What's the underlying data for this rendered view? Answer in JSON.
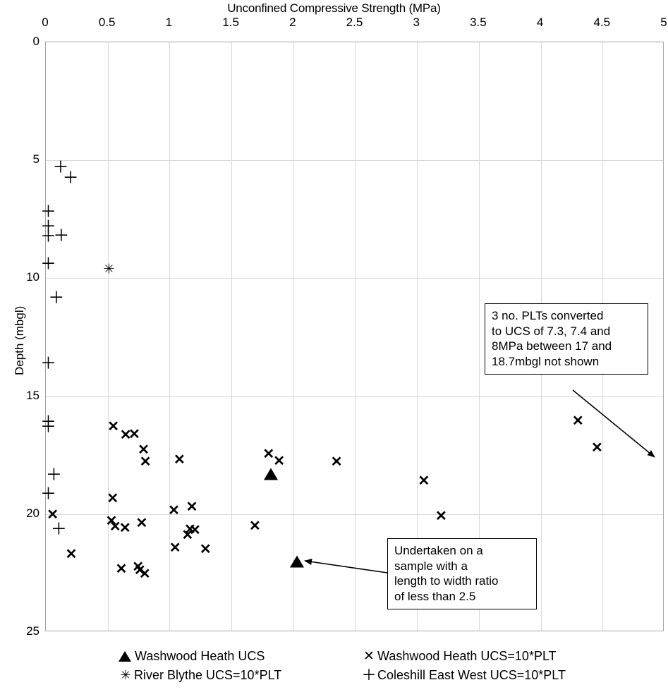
{
  "chart_data": {
    "type": "scatter",
    "title": "Unconfined Compressive Strength (MPa)",
    "xlabel": "Unconfined Compressive Strength (MPa)",
    "ylabel": "Depth (mbgl)",
    "xlim": [
      0,
      5
    ],
    "ylim": [
      0,
      25
    ],
    "y_inverted": true,
    "xticks": [
      "0",
      "0.5",
      "1",
      "1.5",
      "2",
      "2.5",
      "3",
      "3.5",
      "4",
      "4.5",
      "5"
    ],
    "xtick_values": [
      0,
      0.5,
      1,
      1.5,
      2,
      2.5,
      3,
      3.5,
      4,
      4.5,
      5
    ],
    "yticks": [
      "0",
      "5",
      "10",
      "15",
      "20",
      "25"
    ],
    "ytick_values": [
      0,
      5,
      10,
      15,
      20,
      25
    ],
    "grid": "both",
    "legend_position": "bottom",
    "series": [
      {
        "name": "Washwood Heath UCS",
        "marker": "triangle-up-filled",
        "points": [
          {
            "x": 1.82,
            "y": 18.3
          },
          {
            "x": 2.03,
            "y": 22.0
          }
        ]
      },
      {
        "name": "Washwood Heath UCS=10*PLT",
        "marker": "cross-x",
        "points": [
          {
            "x": 0.545,
            "y": 16.3
          },
          {
            "x": 0.645,
            "y": 16.65
          },
          {
            "x": 0.715,
            "y": 16.63
          },
          {
            "x": 0.79,
            "y": 17.28
          },
          {
            "x": 0.805,
            "y": 17.78
          },
          {
            "x": 1.08,
            "y": 17.7
          },
          {
            "x": 1.8,
            "y": 17.45
          },
          {
            "x": 1.885,
            "y": 17.75
          },
          {
            "x": 2.35,
            "y": 17.78
          },
          {
            "x": 3.055,
            "y": 18.6
          },
          {
            "x": 4.3,
            "y": 16.05
          },
          {
            "x": 4.455,
            "y": 17.2
          },
          {
            "x": 0.54,
            "y": 19.35
          },
          {
            "x": 1.18,
            "y": 19.7
          },
          {
            "x": 1.035,
            "y": 19.85
          },
          {
            "x": 0.055,
            "y": 20.05
          },
          {
            "x": 0.53,
            "y": 20.3
          },
          {
            "x": 0.56,
            "y": 20.55
          },
          {
            "x": 0.64,
            "y": 20.6
          },
          {
            "x": 0.775,
            "y": 20.4
          },
          {
            "x": 1.165,
            "y": 20.65
          },
          {
            "x": 1.205,
            "y": 20.7
          },
          {
            "x": 1.145,
            "y": 20.9
          },
          {
            "x": 1.69,
            "y": 20.5
          },
          {
            "x": 3.195,
            "y": 20.1
          },
          {
            "x": 0.205,
            "y": 21.7
          },
          {
            "x": 1.045,
            "y": 21.45
          },
          {
            "x": 1.29,
            "y": 21.5
          },
          {
            "x": 0.61,
            "y": 22.35
          },
          {
            "x": 0.745,
            "y": 22.25
          },
          {
            "x": 0.76,
            "y": 22.4
          },
          {
            "x": 0.8,
            "y": 22.55
          }
        ]
      },
      {
        "name": "River Blythe UCS=10*PLT",
        "marker": "asterisk",
        "points": [
          {
            "x": 0.51,
            "y": 9.62
          }
        ]
      },
      {
        "name": "Coleshill East West UCS=10*PLT",
        "marker": "plus",
        "points": [
          {
            "x": 0.12,
            "y": 5.3
          },
          {
            "x": 0.2,
            "y": 5.75
          },
          {
            "x": 0.02,
            "y": 7.18
          },
          {
            "x": 0.02,
            "y": 7.8
          },
          {
            "x": 0.02,
            "y": 8.22
          },
          {
            "x": 0.125,
            "y": 8.2
          },
          {
            "x": 0.02,
            "y": 9.38
          },
          {
            "x": 0.085,
            "y": 10.82
          },
          {
            "x": 0.02,
            "y": 13.6
          },
          {
            "x": 0.02,
            "y": 16.08
          },
          {
            "x": 0.02,
            "y": 16.3
          },
          {
            "x": 0.065,
            "y": 18.32
          },
          {
            "x": 0.02,
            "y": 19.13
          },
          {
            "x": 0.105,
            "y": 20.62
          }
        ]
      }
    ],
    "annotations": [
      {
        "id": "annotation-plts-not-shown",
        "text": "3 no. PLTs converted\nto UCS of 7.3, 7.4 and\n8MPa between 17 and\n18.7mbgl not shown"
      },
      {
        "id": "annotation-length-width-ratio",
        "text": "Undertaken on a\nsample with a\nlength to width ratio\nof less than 2.5"
      }
    ]
  },
  "legend": {
    "items": [
      {
        "symbol": "▲",
        "label": "Washwood Heath UCS"
      },
      {
        "symbol": "✕",
        "label": "Washwood Heath UCS=10*PLT"
      },
      {
        "symbol": "✳",
        "label": "River Blythe UCS=10*PLT"
      },
      {
        "symbol": "✛",
        "label": "Coleshill East West UCS=10*PLT"
      }
    ]
  },
  "style": {
    "marker_color": "#000000",
    "grid_color": "#d9d9d9",
    "axis_color": "#a6a6a6",
    "background": "#ffffff"
  }
}
